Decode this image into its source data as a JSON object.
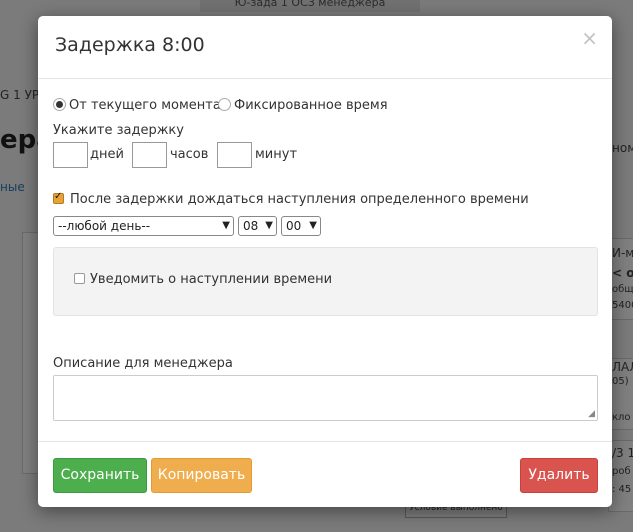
{
  "background": {
    "top_tab": "Ю-зада 1 ОСЗ менеджера",
    "left_fragment": "G 1 УР",
    "heading_fragment": "ера",
    "link_fragment": "ные",
    "right_fragment_1": "ном",
    "right_fragment_2": "И-ма",
    "right_fragment_3": "< от",
    "right_fragment_4": "обще",
    "right_fragment_5": "5400",
    "right_fragment_6": "ЛАЛ",
    "right_fragment_7": "05)",
    "right_fragment_8": "кло",
    "right_fragment_9": "/3 1",
    "right_fragment_10": "роб",
    "right_fragment_11": ": 45",
    "node_label": "Условие выполнено"
  },
  "modal": {
    "title": "Задержка 8:00",
    "close": "×",
    "radio_current": "От текущего момента",
    "radio_fixed": "Фиксированное время",
    "delay_label": "Укажите задержку",
    "days": "дней",
    "hours": "часов",
    "minutes": "минут",
    "wait_checkbox": "После задержки дождаться наступления определенного времени",
    "day_select": "--любой день--",
    "hour_select": "08",
    "minute_select": "00",
    "notify_checkbox": "Уведомить о наступлении времени",
    "description_label": "Описание для менеджера",
    "save": "Сохранить",
    "copy": "Копировать",
    "delete": "Удалить"
  }
}
